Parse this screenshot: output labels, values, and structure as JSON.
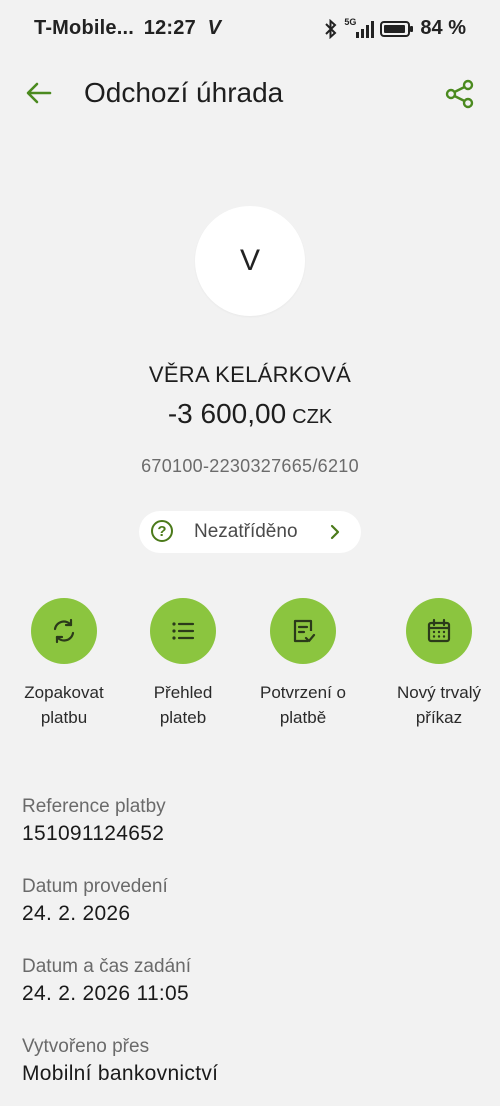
{
  "status_bar": {
    "carrier": "T-Mobile...",
    "time": "12:27",
    "network_mark": "V",
    "network_type": "5G",
    "battery": "84 %",
    "icons": [
      "bluetooth-icon",
      "signal-icon",
      "battery-icon"
    ]
  },
  "app_bar": {
    "title": "Odchozí úhrada",
    "back_icon": "arrow-left-icon",
    "share_icon": "share-icon"
  },
  "payment": {
    "avatar_letter": "V",
    "payee": "VĚRA KELÁRKOVÁ",
    "amount": "-3 600,00",
    "currency": "CZK",
    "account": "670100-2230327665/6210",
    "category": "Nezatříděno"
  },
  "actions": [
    {
      "label_line1": "Zopakovat",
      "label_line2": "platbu",
      "icon": "repeat-icon"
    },
    {
      "label_line1": "Přehled",
      "label_line2": "plateb",
      "icon": "list-icon"
    },
    {
      "label_line1": "Potvrzení o",
      "label_line2": "platbě",
      "icon": "document-check-icon"
    },
    {
      "label_line1": "Nový trvalý",
      "label_line2": "příkaz",
      "icon": "calendar-icon"
    }
  ],
  "details": [
    {
      "label": "Reference platby",
      "value": "151091124652"
    },
    {
      "label": "Datum provedení",
      "value": "24. 2. 2026"
    },
    {
      "label": "Datum a čas zadání",
      "value": "24. 2. 2026 11:05"
    },
    {
      "label": "Vytvořeno přes",
      "value": "Mobilní bankovnictví"
    }
  ],
  "colors": {
    "accent": "#8bc53f",
    "accent_dark": "#4b7a1a",
    "background": "#f2f2f2"
  }
}
